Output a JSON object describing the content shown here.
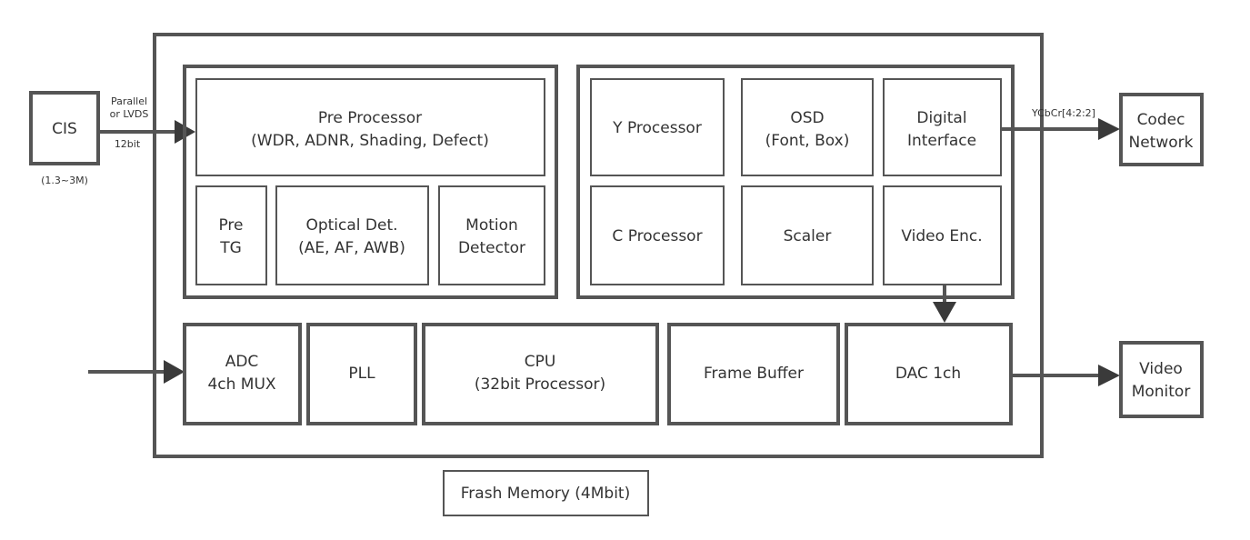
{
  "colors": {
    "stroke": "#555555",
    "arrow": "#3a3a3a",
    "text": "#333333"
  },
  "cis": {
    "label": "CIS",
    "note": "(1.3~3M)",
    "bus_top1": "Parallel",
    "bus_top2": "or LVDS",
    "bus_bottom": "12bit"
  },
  "pre_group": {
    "pre_processor": [
      "Pre Processor",
      "(WDR, ADNR, Shading, Defect)"
    ],
    "pre_tg": [
      "Pre",
      "TG"
    ],
    "optical": [
      "Optical Det.",
      "(AE, AF, AWB)"
    ],
    "motion": [
      "Motion",
      "Detector"
    ]
  },
  "post_group": {
    "y_processor": "Y Processor",
    "osd": [
      "OSD",
      "(Font, Box)"
    ],
    "digital": [
      "Digital",
      "Interface"
    ],
    "c_processor": "C Processor",
    "scaler": "Scaler",
    "video_enc": "Video Enc."
  },
  "bottom": {
    "adc": [
      "ADC",
      "4ch MUX"
    ],
    "pll": "PLL",
    "cpu": [
      "CPU",
      "(32bit Processor)"
    ],
    "frame_buffer": "Frame Buffer",
    "dac": "DAC 1ch"
  },
  "flash": "Frash Memory (4Mbit)",
  "codec": {
    "label": [
      "Codec",
      "Network"
    ],
    "bus": "YCbCr[4:2:2]"
  },
  "monitor": [
    "Video",
    "Monitor"
  ]
}
